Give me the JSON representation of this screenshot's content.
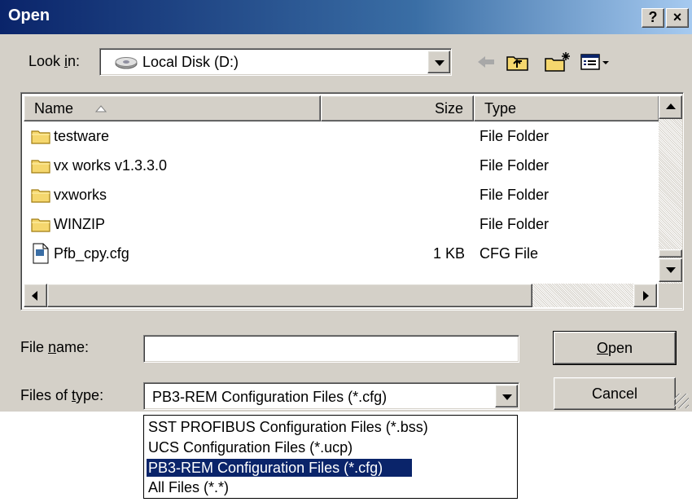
{
  "window": {
    "title": "Open",
    "help_btn": "?",
    "close_btn": "×"
  },
  "toolbar": {
    "look_in_label_pre": "Look ",
    "look_in_label_u": "i",
    "look_in_label_post": "n:",
    "look_in_value": "Local Disk (D:)",
    "icons": [
      "drive-icon",
      "back-arrow-icon",
      "up-folder-icon",
      "new-folder-icon",
      "view-menu-icon"
    ]
  },
  "file_list": {
    "columns": {
      "name": "Name",
      "size": "Size",
      "type": "Type"
    },
    "sort": "name-ascending",
    "rows": [
      {
        "name": "testware",
        "size": "",
        "type": "File Folder",
        "icon": "folder-icon"
      },
      {
        "name": "vx works v1.3.3.0",
        "size": "",
        "type": "File Folder",
        "icon": "folder-icon"
      },
      {
        "name": "vxworks",
        "size": "",
        "type": "File Folder",
        "icon": "folder-icon"
      },
      {
        "name": "WINZIP",
        "size": "",
        "type": "File Folder",
        "icon": "folder-icon"
      },
      {
        "name": "Pfb_cpy.cfg",
        "size": "1 KB",
        "type": "CFG File",
        "icon": "file-icon"
      }
    ]
  },
  "form": {
    "file_name_label_pre": "File ",
    "file_name_label_u": "n",
    "file_name_label_post": "ame:",
    "file_name_value": "",
    "files_of_type_label_pre": "Files of ",
    "files_of_type_label_u": "t",
    "files_of_type_label_post": "ype:",
    "files_of_type_value": "PB3-REM Configuration Files (*.cfg)"
  },
  "buttons": {
    "open_u": "O",
    "open_rest": "pen",
    "cancel": "Cancel"
  },
  "dropdown_options": [
    "SST PROFIBUS Configuration Files (*.bss)",
    "UCS Configuration Files (*.ucp)",
    "PB3-REM Configuration Files (*.cfg)",
    "All Files (*.*)"
  ],
  "selected_option_index": 2,
  "colors": {
    "titlebar": "#0a246a",
    "face": "#d4d0c8",
    "selection": "#0a246a",
    "folder": "#f5d76e"
  }
}
